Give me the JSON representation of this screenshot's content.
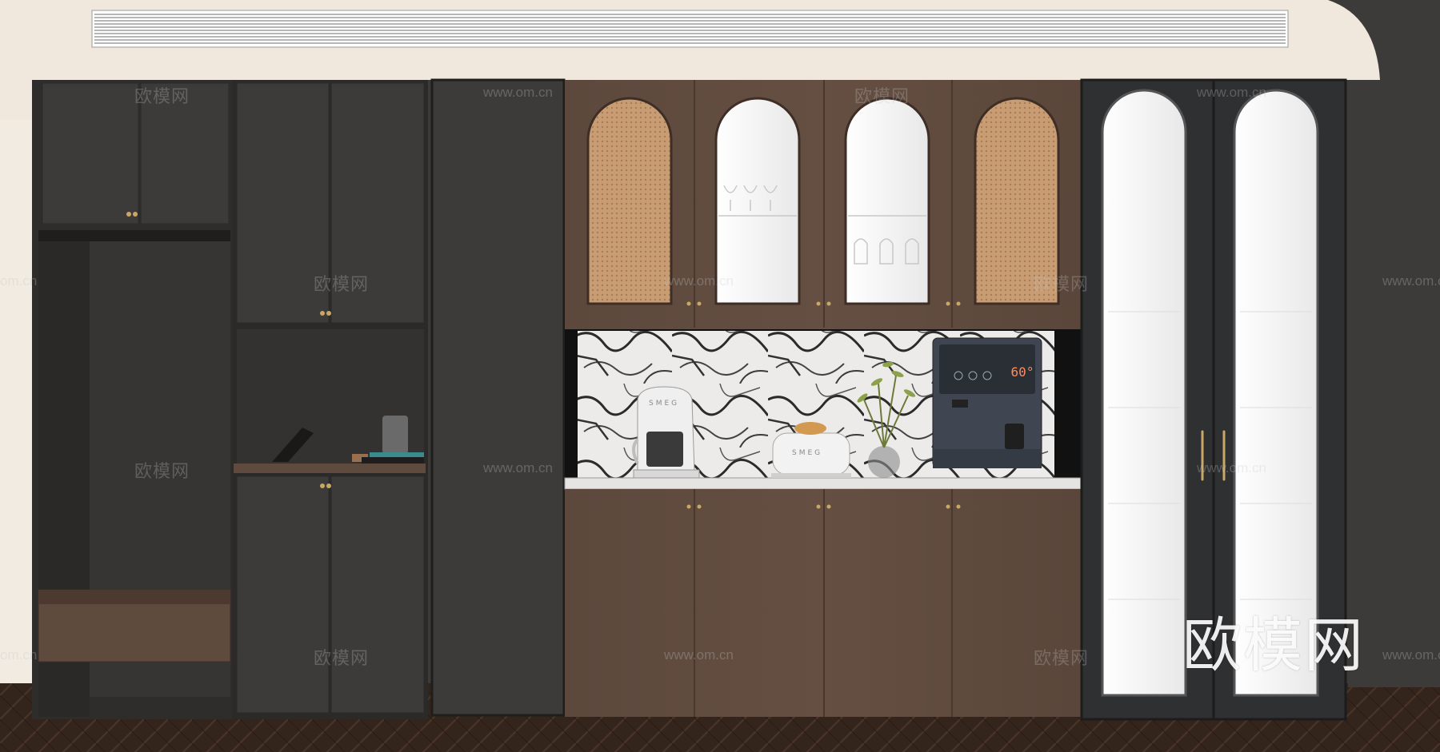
{
  "watermarks": {
    "brand": "欧模网",
    "url": "www.om.cn",
    "url_short": "om.cn",
    "big_logo": "欧模网"
  },
  "appliances": {
    "coffee_maker_brand": "SMEG",
    "toaster_brand": "SMEG",
    "water_dispenser_display": "60°"
  },
  "colors": {
    "dark_cabinet": "#3b3a39",
    "wood_cabinet": "#5f4a3e",
    "rattan": "#c9a07a",
    "ceiling": "#f0e8dc",
    "floor": "#3a2a20",
    "brass_handle": "#c9a866"
  }
}
